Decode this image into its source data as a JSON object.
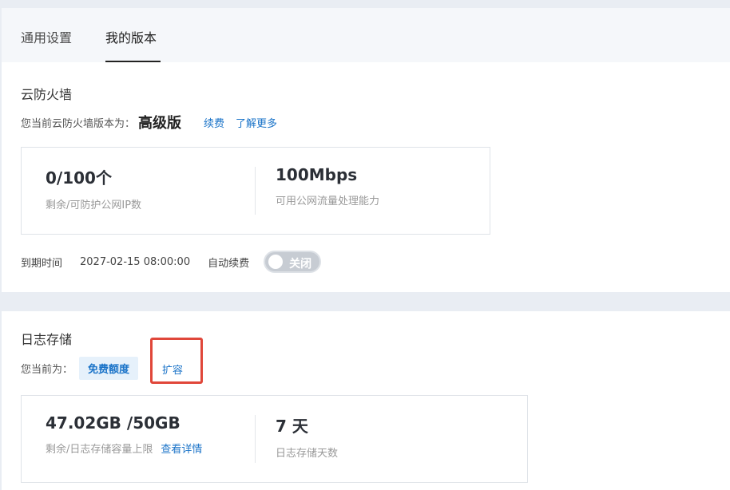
{
  "tabs": [
    {
      "label": "通用设置"
    },
    {
      "label": "我的版本"
    }
  ],
  "firewall": {
    "title": "云防火墙",
    "version_prefix": "您当前云防火墙版本为：",
    "version_name": "高级版",
    "renew_link": "续费",
    "learn_more_link": "了解更多",
    "stats": [
      {
        "value": "0/100个",
        "label": "剩余/可防护公网IP数"
      },
      {
        "value": "100Mbps",
        "label": "可用公网流量处理能力"
      }
    ],
    "expiry_label": "到期时间",
    "expiry_value": "2027-02-15 08:00:00",
    "auto_renew_label": "自动续费",
    "auto_renew_toggle": "关闭"
  },
  "logs": {
    "title": "日志存储",
    "current_prefix": "您当前为：",
    "quota_badge": "免费额度",
    "expand_link": "扩容",
    "stats": [
      {
        "value": "47.02GB /50GB",
        "label": "剩余/日志存储容量上限",
        "link": "查看详情"
      },
      {
        "value": "7 天",
        "label": "日志存储天数"
      }
    ]
  },
  "colors": {
    "link": "#1a73c8",
    "highlight_box": "#e0473a",
    "badge_bg": "#e6f1fb",
    "toggle_off": "#c7ccd3"
  }
}
